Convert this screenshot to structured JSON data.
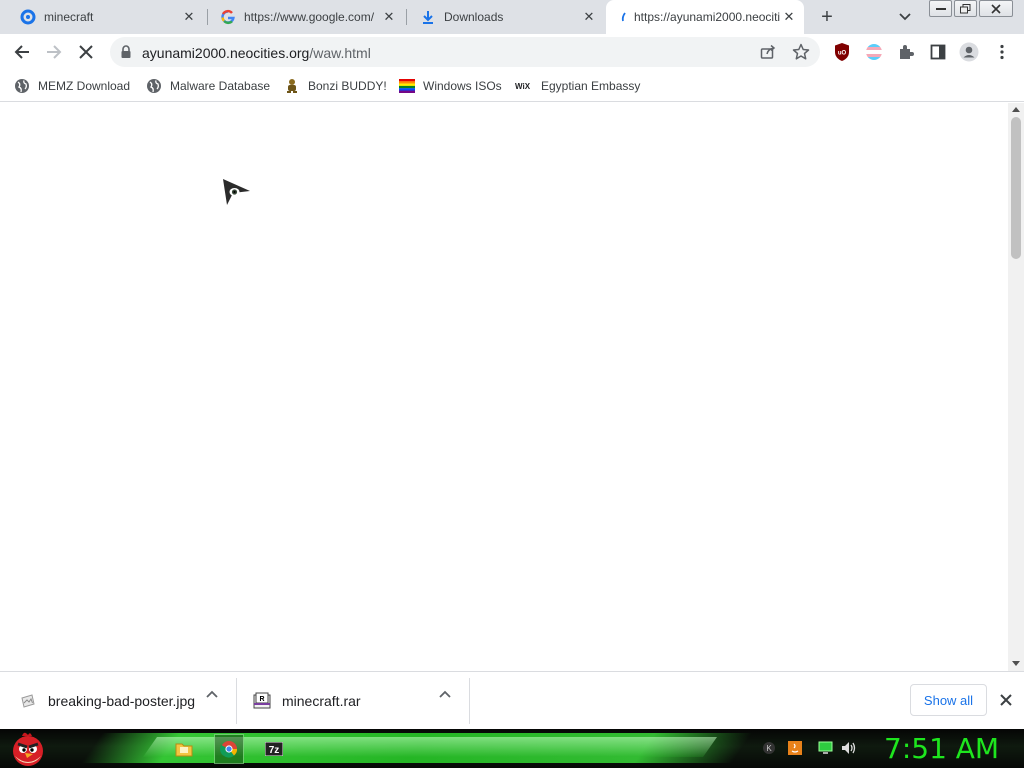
{
  "tabs": [
    {
      "title": "minecraft",
      "favicon": "blue-circle-icon",
      "active": false
    },
    {
      "title": "https://www.google.com/",
      "favicon": "google-icon",
      "active": false
    },
    {
      "title": "Downloads",
      "favicon": "download-icon",
      "active": false
    },
    {
      "title": "https://ayunami2000.neocities.org/waw.html",
      "favicon": "loading-icon",
      "active": true
    }
  ],
  "toolbar": {
    "url_host": "ayunami2000.neocities.org",
    "url_path": "/waw.html"
  },
  "bookmarks": [
    {
      "label": "MEMZ Download",
      "icon": "globe-icon"
    },
    {
      "label": "Malware Database",
      "icon": "globe-icon"
    },
    {
      "label": "Bonzi BUDDY!",
      "icon": "bonzi-icon"
    },
    {
      "label": "Windows ISOs",
      "icon": "rainbow-flag-icon"
    },
    {
      "label": "Egyptian Embassy",
      "icon": "wix-icon"
    }
  ],
  "downloads": {
    "items": [
      {
        "name": "breaking-bad-poster.jpg",
        "icon": "image-file-icon"
      },
      {
        "name": "minecraft.rar",
        "icon": "rar-archive-icon"
      }
    ],
    "show_all_label": "Show all"
  },
  "taskbar": {
    "clock": "7:51 AM",
    "apps": [
      "file-explorer-icon",
      "chrome-icon",
      "7zip-icon"
    ],
    "accent": "#1ee61e"
  }
}
